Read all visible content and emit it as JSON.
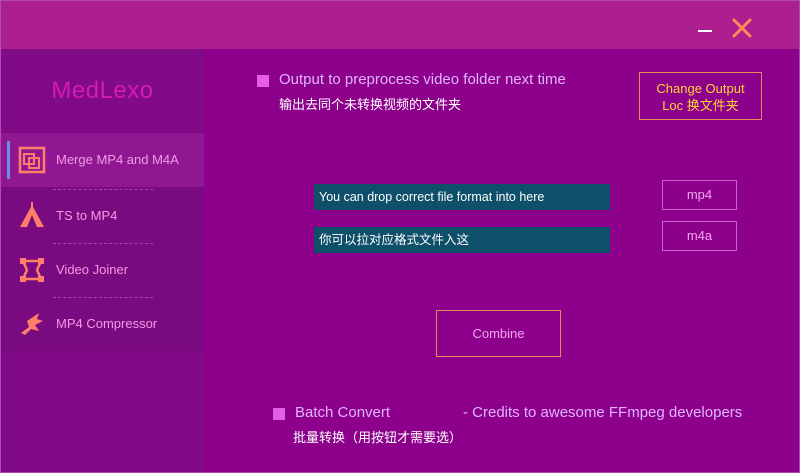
{
  "window": {
    "minimize_icon": "minimize-icon",
    "close_icon": "close-icon",
    "accent": "#ff8a5a"
  },
  "sidebar": {
    "brand": "MedLexo",
    "items": [
      {
        "label": "Merge MP4 and M4A",
        "icon": "merge-layers-icon",
        "active": true
      },
      {
        "label": "TS to MP4",
        "icon": "tent-icon",
        "active": false
      },
      {
        "label": "Video Joiner",
        "icon": "vector-frame-icon",
        "active": false
      },
      {
        "label": "MP4 Compressor",
        "icon": "figure-icon",
        "active": false
      }
    ]
  },
  "options": {
    "output_label": "Output to preprocess video folder next time",
    "output_sub": "输出去同个未转换视频的文件夹",
    "change_output_line1": "Change Output",
    "change_output_line2": "Loc 换文件夹"
  },
  "inputs": {
    "mp4_field": "You can drop correct file format into here",
    "m4a_field": "你可以拉对应格式文件入这",
    "mp4_button": "mp4",
    "m4a_button": "m4a"
  },
  "actions": {
    "combine": "Combine"
  },
  "footer": {
    "batch_label": "Batch Convert",
    "batch_sub": "批量转换（用按钮才需要选）",
    "credits": "- Credits to awesome FFmpeg developers"
  }
}
